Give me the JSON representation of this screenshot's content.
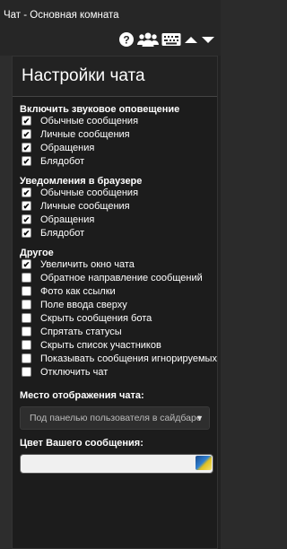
{
  "window": {
    "title": "Чат - Основная комната"
  },
  "toolbar": {
    "icons": [
      "help-icon",
      "users-icon",
      "keyboard-icon",
      "arrow-up-icon",
      "arrow-down-icon"
    ]
  },
  "panel": {
    "title": "Настройки чата",
    "sound": {
      "title": "Включить звуковое оповещение",
      "items": [
        {
          "label": "Обычные сообщения",
          "checked": true
        },
        {
          "label": "Личные сообщения",
          "checked": true
        },
        {
          "label": "Обращения",
          "checked": true
        },
        {
          "label": "Блядобот",
          "checked": true
        }
      ]
    },
    "browser": {
      "title": "Уведомления в браузере",
      "items": [
        {
          "label": "Обычные сообщения",
          "checked": true
        },
        {
          "label": "Личные сообщения",
          "checked": true
        },
        {
          "label": "Обращения",
          "checked": true
        },
        {
          "label": "Блядобот",
          "checked": true
        }
      ]
    },
    "other": {
      "title": "Другое",
      "items": [
        {
          "label": "Увеличить окно чата",
          "checked": true
        },
        {
          "label": "Обратное направление сообщений",
          "checked": false
        },
        {
          "label": "Фото как ссылки",
          "checked": false
        },
        {
          "label": "Поле ввода сверху",
          "checked": false
        },
        {
          "label": "Скрыть сообщения бота",
          "checked": false
        },
        {
          "label": "Спрятать статусы",
          "checked": false
        },
        {
          "label": "Скрыть список участников",
          "checked": false
        },
        {
          "label": "Показывать сообщения игнорируемых",
          "checked": false
        },
        {
          "label": "Отключить чат",
          "checked": false
        }
      ]
    },
    "location": {
      "label": "Место отображения чата:",
      "value": "Под панелью пользователя в сайдбаре"
    },
    "color": {
      "label": "Цвет Вашего сообщения:"
    }
  }
}
